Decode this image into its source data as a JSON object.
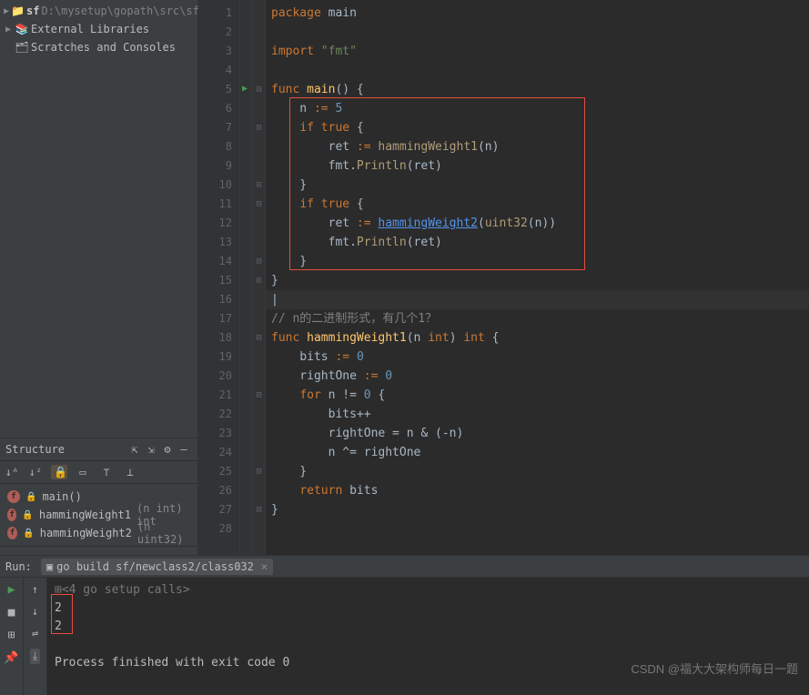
{
  "project": {
    "folder_icon": "📁",
    "name": "sf",
    "path": "D:\\mysetup\\gopath\\src\\sf",
    "ext_lib_icon": "📚",
    "ext_lib": "External Libraries",
    "scratch_icon": "🗂",
    "scratch": "Scratches and Consoles"
  },
  "structure": {
    "title": "Structure",
    "items": [
      {
        "name": "main()",
        "sig": ""
      },
      {
        "name": "hammingWeight1",
        "sig": "(n int) int"
      },
      {
        "name": "hammingWeight2",
        "sig": "(n uint32)"
      }
    ]
  },
  "code": {
    "lines": [
      {
        "n": "1",
        "html": "<span class='kw'>package</span> <span class='ident'>main</span>"
      },
      {
        "n": "2",
        "html": ""
      },
      {
        "n": "3",
        "html": "<span class='kw'>import</span> <span class='str'>\"fmt\"</span>"
      },
      {
        "n": "4",
        "html": ""
      },
      {
        "n": "5",
        "html": "<span class='kw'>func</span> <span class='fn'>main</span>() {",
        "run": true,
        "fold": "⊟"
      },
      {
        "n": "6",
        "html": "    n <span class='kw'>:=</span> <span class='num'>5</span>"
      },
      {
        "n": "7",
        "html": "    <span class='kw'>if</span> <span class='kw'>true</span> {",
        "fold": "⊟"
      },
      {
        "n": "8",
        "html": "        ret <span class='kw'>:=</span> <span class='call'>hammingWeight1</span>(n)"
      },
      {
        "n": "9",
        "html": "        fmt.<span class='call'>Println</span>(ret)"
      },
      {
        "n": "10",
        "html": "    }",
        "fold": "⊟"
      },
      {
        "n": "11",
        "html": "    <span class='kw'>if</span> <span class='kw'>true</span> {",
        "fold": "⊟"
      },
      {
        "n": "12",
        "html": "        ret <span class='kw'>:=</span> <span class='link'>hammingWeight2</span>(<span class='call'>uint32</span>(n))"
      },
      {
        "n": "13",
        "html": "        fmt.<span class='call'>Println</span>(ret)"
      },
      {
        "n": "14",
        "html": "    }",
        "fold": "⊟"
      },
      {
        "n": "15",
        "html": "}",
        "fold": "⊟"
      },
      {
        "n": "16",
        "html": "<span class='ident'>|</span>",
        "current": true
      },
      {
        "n": "17",
        "html": "<span class='com'>// n的二进制形式，有几个1？</span>"
      },
      {
        "n": "18",
        "html": "<span class='kw'>func</span> <span class='fn'>hammingWeight1</span>(n <span class='typ'>int</span>) <span class='typ'>int</span> {",
        "fold": "⊟"
      },
      {
        "n": "19",
        "html": "    bits <span class='kw'>:=</span> <span class='num'>0</span>"
      },
      {
        "n": "20",
        "html": "    rightOne <span class='kw'>:=</span> <span class='num'>0</span>"
      },
      {
        "n": "21",
        "html": "    <span class='kw'>for</span> n != <span class='num'>0</span> {",
        "fold": "⊟"
      },
      {
        "n": "22",
        "html": "        bits++"
      },
      {
        "n": "23",
        "html": "        rightOne = n &amp; (-n)"
      },
      {
        "n": "24",
        "html": "        n ^= rightOne"
      },
      {
        "n": "25",
        "html": "    }",
        "fold": "⊟"
      },
      {
        "n": "26",
        "html": "    <span class='kw'>return</span> bits"
      },
      {
        "n": "27",
        "html": "}",
        "fold": "⊟"
      },
      {
        "n": "28",
        "html": ""
      }
    ]
  },
  "run": {
    "label": "Run:",
    "tab_icon": "▣",
    "tab": "go build sf/newclass2/class032",
    "console": {
      "setup": "⊞<4 go setup calls>",
      "out1": "2",
      "out2": "2",
      "blank": "",
      "exit": "Process finished with exit code 0"
    }
  },
  "watermark": "CSDN @福大大架构师每日一题"
}
